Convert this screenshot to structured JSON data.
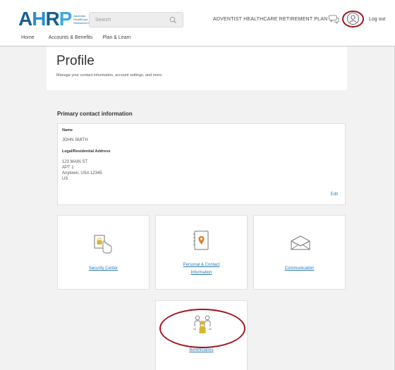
{
  "header": {
    "logo_text": "AHRP",
    "logo_subtext": "Adventist HealthCare Retirement Plans",
    "search_placeholder": "Search",
    "plan_name": "ADVENTIST HEALTHCARE RETIREMENT PLAN",
    "logout_label": "Log out"
  },
  "nav": {
    "items": [
      "Home",
      "Accounts & Benefits",
      "Plan & Learn"
    ]
  },
  "profile": {
    "title": "Profile",
    "subtitle": "Manage your contact information, account settings, and more."
  },
  "contact": {
    "section_title": "Primary contact information",
    "name_label": "Name",
    "name_value": "JOHN SMITH",
    "address_label": "Legal/Residential Address",
    "address_lines": [
      "123 MAIN ST",
      "APT 1",
      "Anytown, USA 12345",
      "US"
    ],
    "edit_label": "Edit"
  },
  "tiles": {
    "security": "Security Center",
    "personal_line1": "Personal & Contact",
    "personal_line2": "Information",
    "communication": "Communication",
    "beneficiaries": "Beneficiaries"
  },
  "colors": {
    "brand_dark": "#1b5e8e",
    "brand_light": "#3aaadf",
    "link": "#2b7ab5",
    "highlight": "#a0141c",
    "icon_orange": "#e0802b",
    "icon_yellow": "#d9b62f"
  }
}
